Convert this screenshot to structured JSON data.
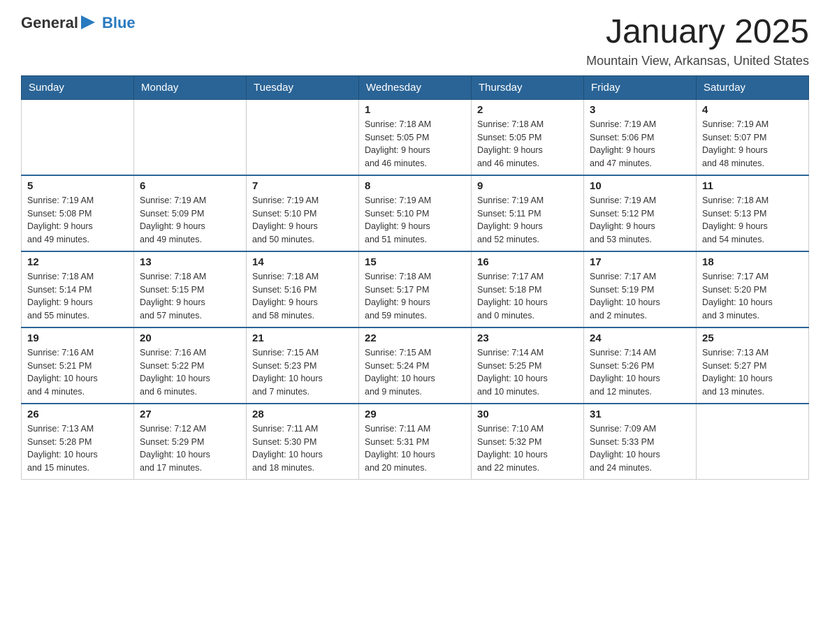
{
  "header": {
    "logo_general": "General",
    "logo_blue": "Blue",
    "month_title": "January 2025",
    "location": "Mountain View, Arkansas, United States"
  },
  "days_of_week": [
    "Sunday",
    "Monday",
    "Tuesday",
    "Wednesday",
    "Thursday",
    "Friday",
    "Saturday"
  ],
  "weeks": [
    [
      {
        "day": "",
        "info": ""
      },
      {
        "day": "",
        "info": ""
      },
      {
        "day": "",
        "info": ""
      },
      {
        "day": "1",
        "info": "Sunrise: 7:18 AM\nSunset: 5:05 PM\nDaylight: 9 hours\nand 46 minutes."
      },
      {
        "day": "2",
        "info": "Sunrise: 7:18 AM\nSunset: 5:05 PM\nDaylight: 9 hours\nand 46 minutes."
      },
      {
        "day": "3",
        "info": "Sunrise: 7:19 AM\nSunset: 5:06 PM\nDaylight: 9 hours\nand 47 minutes."
      },
      {
        "day": "4",
        "info": "Sunrise: 7:19 AM\nSunset: 5:07 PM\nDaylight: 9 hours\nand 48 minutes."
      }
    ],
    [
      {
        "day": "5",
        "info": "Sunrise: 7:19 AM\nSunset: 5:08 PM\nDaylight: 9 hours\nand 49 minutes."
      },
      {
        "day": "6",
        "info": "Sunrise: 7:19 AM\nSunset: 5:09 PM\nDaylight: 9 hours\nand 49 minutes."
      },
      {
        "day": "7",
        "info": "Sunrise: 7:19 AM\nSunset: 5:10 PM\nDaylight: 9 hours\nand 50 minutes."
      },
      {
        "day": "8",
        "info": "Sunrise: 7:19 AM\nSunset: 5:10 PM\nDaylight: 9 hours\nand 51 minutes."
      },
      {
        "day": "9",
        "info": "Sunrise: 7:19 AM\nSunset: 5:11 PM\nDaylight: 9 hours\nand 52 minutes."
      },
      {
        "day": "10",
        "info": "Sunrise: 7:19 AM\nSunset: 5:12 PM\nDaylight: 9 hours\nand 53 minutes."
      },
      {
        "day": "11",
        "info": "Sunrise: 7:18 AM\nSunset: 5:13 PM\nDaylight: 9 hours\nand 54 minutes."
      }
    ],
    [
      {
        "day": "12",
        "info": "Sunrise: 7:18 AM\nSunset: 5:14 PM\nDaylight: 9 hours\nand 55 minutes."
      },
      {
        "day": "13",
        "info": "Sunrise: 7:18 AM\nSunset: 5:15 PM\nDaylight: 9 hours\nand 57 minutes."
      },
      {
        "day": "14",
        "info": "Sunrise: 7:18 AM\nSunset: 5:16 PM\nDaylight: 9 hours\nand 58 minutes."
      },
      {
        "day": "15",
        "info": "Sunrise: 7:18 AM\nSunset: 5:17 PM\nDaylight: 9 hours\nand 59 minutes."
      },
      {
        "day": "16",
        "info": "Sunrise: 7:17 AM\nSunset: 5:18 PM\nDaylight: 10 hours\nand 0 minutes."
      },
      {
        "day": "17",
        "info": "Sunrise: 7:17 AM\nSunset: 5:19 PM\nDaylight: 10 hours\nand 2 minutes."
      },
      {
        "day": "18",
        "info": "Sunrise: 7:17 AM\nSunset: 5:20 PM\nDaylight: 10 hours\nand 3 minutes."
      }
    ],
    [
      {
        "day": "19",
        "info": "Sunrise: 7:16 AM\nSunset: 5:21 PM\nDaylight: 10 hours\nand 4 minutes."
      },
      {
        "day": "20",
        "info": "Sunrise: 7:16 AM\nSunset: 5:22 PM\nDaylight: 10 hours\nand 6 minutes."
      },
      {
        "day": "21",
        "info": "Sunrise: 7:15 AM\nSunset: 5:23 PM\nDaylight: 10 hours\nand 7 minutes."
      },
      {
        "day": "22",
        "info": "Sunrise: 7:15 AM\nSunset: 5:24 PM\nDaylight: 10 hours\nand 9 minutes."
      },
      {
        "day": "23",
        "info": "Sunrise: 7:14 AM\nSunset: 5:25 PM\nDaylight: 10 hours\nand 10 minutes."
      },
      {
        "day": "24",
        "info": "Sunrise: 7:14 AM\nSunset: 5:26 PM\nDaylight: 10 hours\nand 12 minutes."
      },
      {
        "day": "25",
        "info": "Sunrise: 7:13 AM\nSunset: 5:27 PM\nDaylight: 10 hours\nand 13 minutes."
      }
    ],
    [
      {
        "day": "26",
        "info": "Sunrise: 7:13 AM\nSunset: 5:28 PM\nDaylight: 10 hours\nand 15 minutes."
      },
      {
        "day": "27",
        "info": "Sunrise: 7:12 AM\nSunset: 5:29 PM\nDaylight: 10 hours\nand 17 minutes."
      },
      {
        "day": "28",
        "info": "Sunrise: 7:11 AM\nSunset: 5:30 PM\nDaylight: 10 hours\nand 18 minutes."
      },
      {
        "day": "29",
        "info": "Sunrise: 7:11 AM\nSunset: 5:31 PM\nDaylight: 10 hours\nand 20 minutes."
      },
      {
        "day": "30",
        "info": "Sunrise: 7:10 AM\nSunset: 5:32 PM\nDaylight: 10 hours\nand 22 minutes."
      },
      {
        "day": "31",
        "info": "Sunrise: 7:09 AM\nSunset: 5:33 PM\nDaylight: 10 hours\nand 24 minutes."
      },
      {
        "day": "",
        "info": ""
      }
    ]
  ]
}
